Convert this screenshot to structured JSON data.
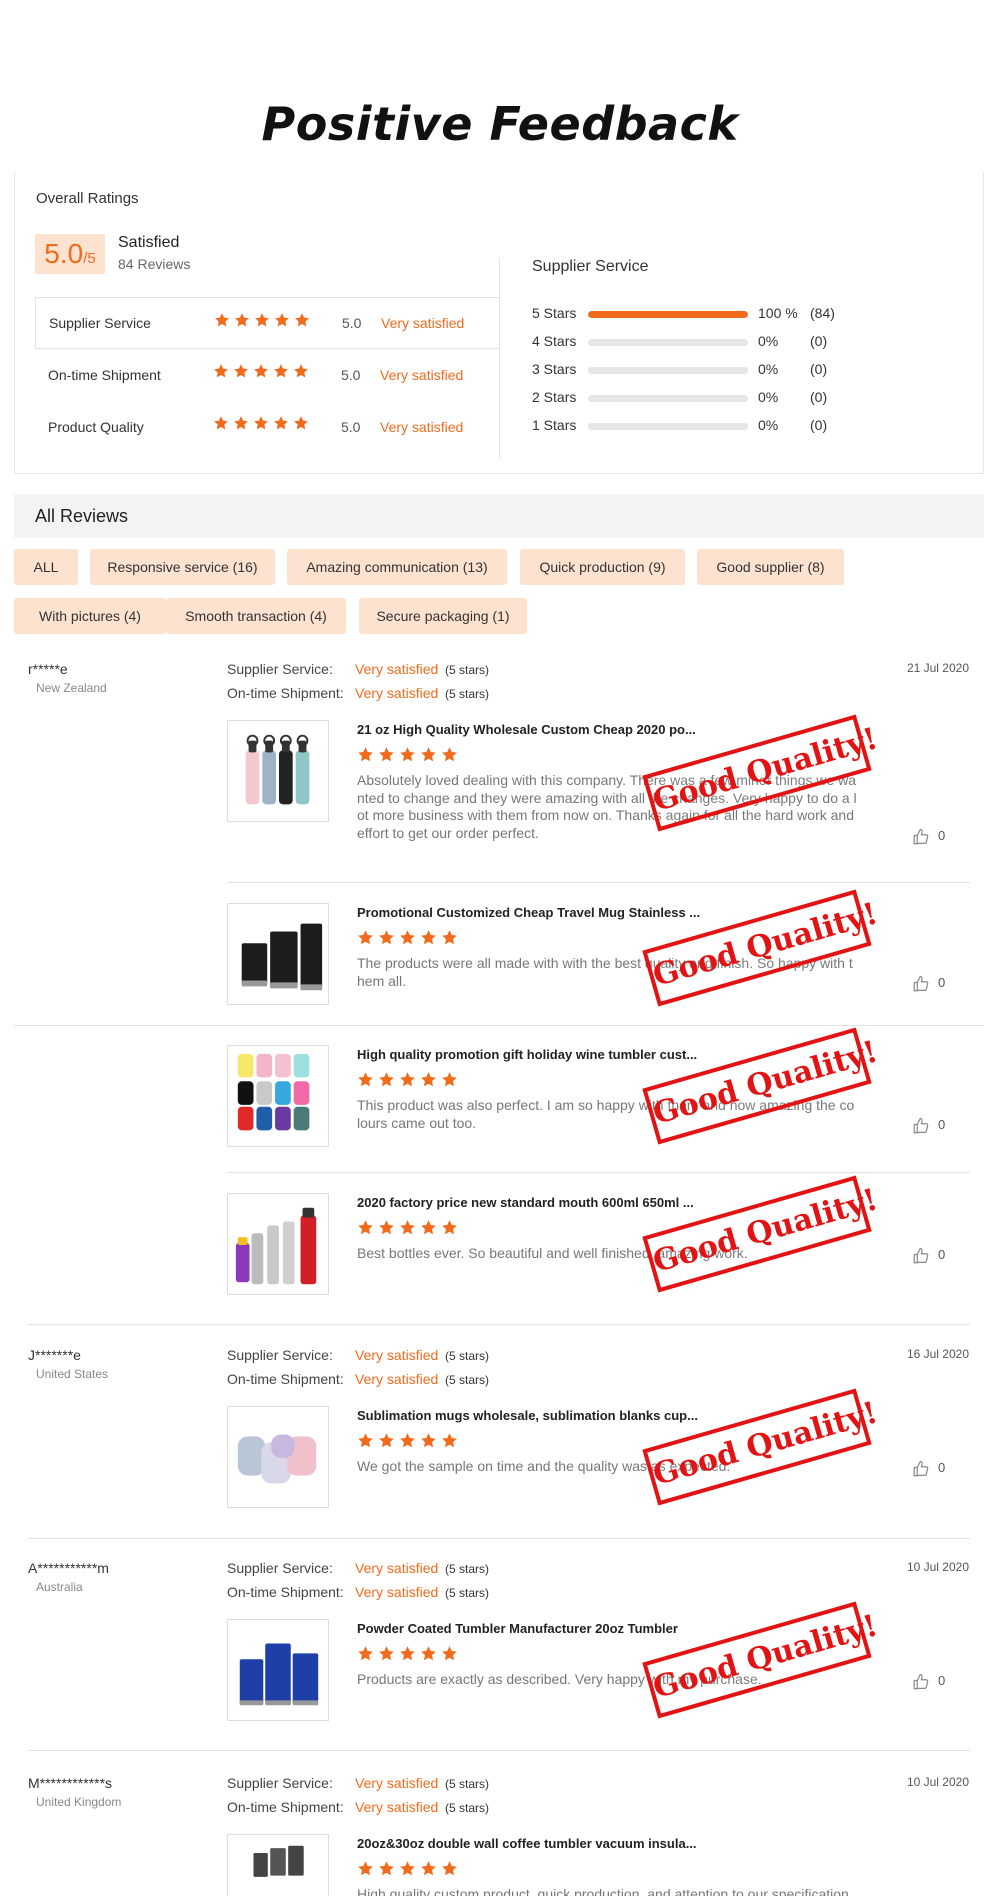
{
  "page": {
    "title": "Positive Feedback"
  },
  "ratings": {
    "overall_label": "Overall Ratings",
    "score": "5.0",
    "score_denominator": "/5",
    "satisfaction": "Satisfied",
    "reviews_count": "84 Reviews",
    "rows": [
      {
        "label": "Supplier Service",
        "stars": 5,
        "value": "5.0",
        "text": "Very satisfied"
      },
      {
        "label": "On-time Shipment",
        "stars": 5,
        "value": "5.0",
        "text": "Very satisfied"
      },
      {
        "label": "Product Quality",
        "stars": 5,
        "value": "5.0",
        "text": "Very satisfied"
      }
    ],
    "supplier_service": {
      "title": "Supplier Service",
      "distribution": [
        {
          "label": "5  Stars",
          "fraction": 1.0,
          "pct": "100 %",
          "count": "(84)"
        },
        {
          "label": "4  Stars",
          "fraction": 0,
          "pct": "0%",
          "count": "(0)"
        },
        {
          "label": "3  Stars",
          "fraction": 0,
          "pct": "0%",
          "count": "(0)"
        },
        {
          "label": "2  Stars",
          "fraction": 0,
          "pct": "0%",
          "count": "(0)"
        },
        {
          "label": "1  Stars",
          "fraction": 0,
          "pct": "0%",
          "count": "(0)"
        }
      ]
    }
  },
  "all_reviews": {
    "title": "All Reviews",
    "tags": [
      "ALL",
      "Responsive service (16)",
      "Amazing communication (13)",
      "Quick production (9)",
      "Good supplier (8)",
      "With pictures (4)",
      "Smooth transaction (4)",
      "Secure packaging (1)"
    ]
  },
  "labels": {
    "supplier_service": "Supplier Service:",
    "ontime_shipment": "On-time Shipment:",
    "very_satisfied": "Very satisfied",
    "five_stars": "(5 stars)",
    "stamp": "Good Quality!"
  },
  "reviews": [
    {
      "name": "r*****e",
      "country": "New Zealand",
      "date": "21 Jul 2020",
      "products": [
        {
          "title": "21 oz High Quality Wholesale Custom Cheap 2020 po...",
          "text": "Absolutely loved dealing with this company. There was a few minor things we wanted to change and they were amazing with all the changes. Very happy to do a lot more business with them from now on. Thanks again for all the hard work and effort to get our order perfect.",
          "likes": "0",
          "image": "bottles-pastel"
        },
        {
          "title": "Promotional Customized Cheap Travel Mug Stainless ...",
          "text": "The products were all made with with the best quality and finish. So happy with them all.",
          "likes": "0",
          "image": "mugs-black"
        },
        {
          "title": "High quality promotion gift holiday wine tumbler cust...",
          "text": "This product was also perfect. I am so happy with them and how amazing the colours came out too.",
          "likes": "0",
          "image": "tumblers-color"
        },
        {
          "title": "2020 factory price new standard mouth 600ml 650ml ...",
          "text": "Best bottles ever. So beautiful and well finished, amazing work.",
          "likes": "0",
          "image": "bottles-steel"
        }
      ]
    },
    {
      "name": "J*******e",
      "country": "United States",
      "date": "16 Jul 2020",
      "products": [
        {
          "title": "Sublimation mugs wholesale, sublimation blanks cup...",
          "text": "We got the sample on time and the quality was as expected.",
          "likes": "0",
          "image": "cups-gradient"
        }
      ]
    },
    {
      "name": "A***********m",
      "country": "Australia",
      "date": "10 Jul 2020",
      "products": [
        {
          "title": "Powder Coated Tumbler Manufacturer 20oz Tumbler",
          "text": "Products are exactly as described. Very happy with my purchase.",
          "likes": "0",
          "image": "tumblers-blue"
        }
      ]
    },
    {
      "name": "M************s",
      "country": "United Kingdom",
      "date": "10 Jul 2020",
      "products": [
        {
          "title": "20oz&30oz double wall coffee tumbler vacuum insula...",
          "text": "High quality custom product, quick production, and attention to our specification.",
          "likes": "",
          "image": "tumblers-gray"
        }
      ]
    }
  ],
  "colors": {
    "accent": "#f26a1b",
    "tag_bg": "#fde2d0",
    "stamp": "#e31313"
  }
}
